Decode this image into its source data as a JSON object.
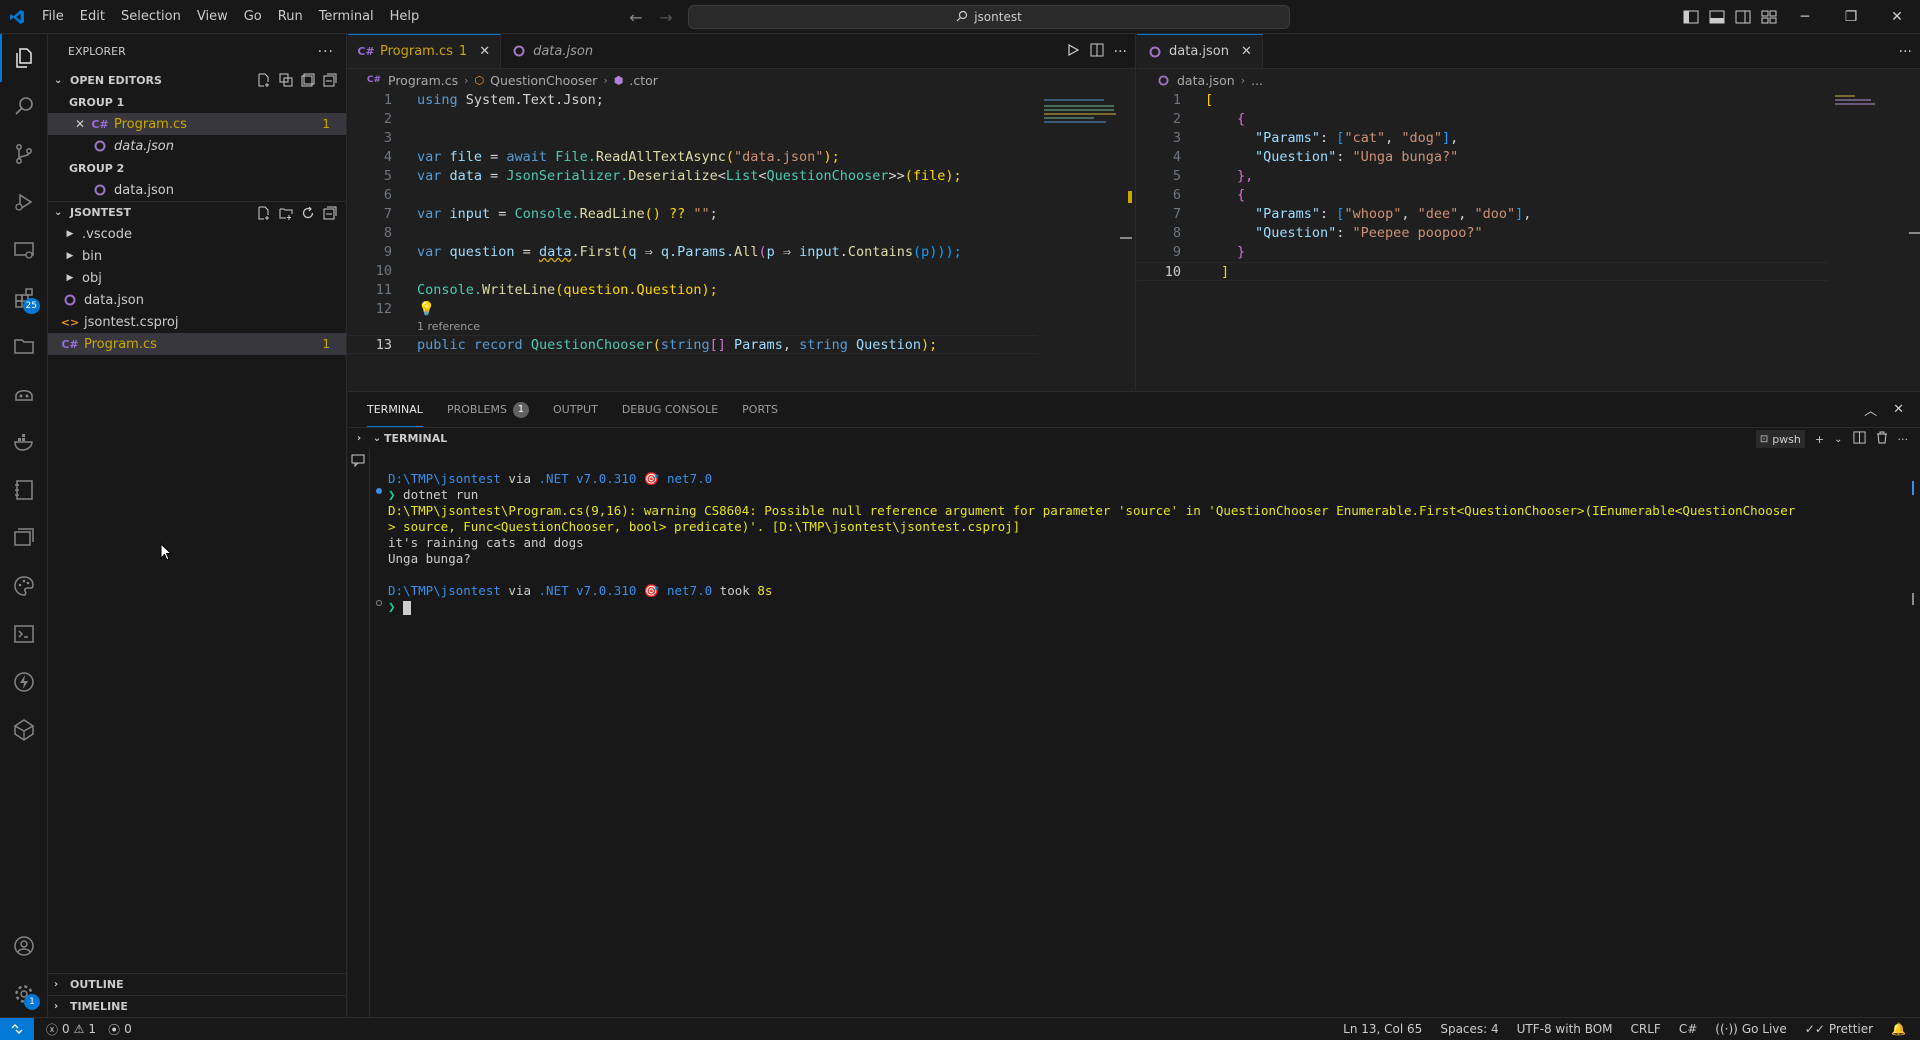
{
  "title_bar": {
    "menu": [
      "File",
      "Edit",
      "Selection",
      "View",
      "Go",
      "Run",
      "Terminal",
      "Help"
    ],
    "search_text": "jsontest"
  },
  "activity_bar": {
    "extensions_badge": "25",
    "settings_badge": "1"
  },
  "explorer": {
    "header": "EXPLORER",
    "open_editors": {
      "label": "OPEN EDITORS",
      "group1_label": "GROUP 1",
      "group2_label": "GROUP 2",
      "group1_files": [
        {
          "name": "Program.cs",
          "badge": "1"
        },
        {
          "name": "data.json"
        }
      ],
      "group2_files": [
        {
          "name": "data.json"
        }
      ]
    },
    "project": {
      "label": "JSONTEST",
      "items": [
        {
          "name": ".vscode"
        },
        {
          "name": "bin"
        },
        {
          "name": "obj"
        },
        {
          "name": "data.json"
        },
        {
          "name": "jsontest.csproj"
        },
        {
          "name": "Program.cs",
          "badge": "1"
        }
      ]
    },
    "outline_label": "OUTLINE",
    "timeline_label": "TIMELINE"
  },
  "editor_left": {
    "tabs": [
      {
        "label": "Program.cs",
        "suffix": "1"
      },
      {
        "label": "data.json"
      }
    ],
    "breadcrumb": [
      "Program.cs",
      "QuestionChooser",
      ".ctor"
    ],
    "line_numbers": [
      "1",
      "2",
      "3",
      "4",
      "5",
      "6",
      "7",
      "8",
      "9",
      "10",
      "11",
      "12",
      "13"
    ],
    "codelens": "1 reference",
    "code": {
      "l1": {
        "a": "using",
        "b": " System.Text.Json;"
      },
      "l4": {
        "a": "var",
        "b": " file",
        "c": " = ",
        "d": "await",
        "e": " File.",
        "f": "ReadAllTextAsync",
        "g": "(",
        "h": "\"data.json\"",
        "i": ");"
      },
      "l5": {
        "a": "var",
        "b": " data",
        "c": " = ",
        "d": "JsonSerializer.",
        "e": "Deserialize",
        "f": "<",
        "g": "List",
        "h": "<",
        "i": "QuestionChooser",
        "j": ">>",
        "k": "(file);"
      },
      "l7": {
        "a": "var",
        "b": " input",
        "c": " = ",
        "d": "Console.",
        "e": "ReadLine",
        "f": "() ?? ",
        "g": "\"\"",
        "h": ";"
      },
      "l9": {
        "a": "var",
        "b": " question",
        "c": " = ",
        "d": "data",
        "e": ".",
        "f": "First",
        "g": "(",
        "h": "q",
        "i": " ⇒ ",
        "j": "q",
        "k": ".Params.",
        "l": "All",
        "m": "(",
        "n": "p",
        "o": " ⇒ ",
        "p": "input",
        "q": ".",
        "r": "Contains",
        "s": "(p)));"
      },
      "l11": {
        "a": "Console.",
        "b": "WriteLine",
        "c": "(question.Question);"
      },
      "l13": {
        "a": "public",
        "b": " record",
        "c": " QuestionChooser",
        "d": "(",
        "e": "string",
        "f": "[]",
        "g": " Params",
        "h": ", ",
        "i": "string",
        "j": " Question",
        "k": ");"
      }
    }
  },
  "editor_right": {
    "tabs": [
      {
        "label": "data.json"
      }
    ],
    "breadcrumb": [
      "data.json",
      "..."
    ],
    "line_numbers": [
      "1",
      "2",
      "3",
      "4",
      "5",
      "6",
      "7",
      "8",
      "9",
      "10"
    ],
    "code": {
      "l1": "[",
      "l2": "{",
      "l3": {
        "key": "\"Params\"",
        "colon": ": ",
        "open": "[",
        "v1": "\"cat\"",
        "sep": ", ",
        "v2": "\"dog\"",
        "close": "]",
        "end": ","
      },
      "l4": {
        "key": "\"Question\"",
        "colon": ": ",
        "val": "\"Unga bunga?\""
      },
      "l5": "},",
      "l6": "{",
      "l7": {
        "key": "\"Params\"",
        "colon": ": ",
        "open": "[",
        "v1": "\"whoop\"",
        "sep1": ", ",
        "v2": "\"dee\"",
        "sep2": ", ",
        "v3": "\"doo\"",
        "close": "]",
        "end": ","
      },
      "l8": {
        "key": "\"Question\"",
        "colon": ": ",
        "val": "\"Peepee poopoo?\""
      },
      "l9": "}",
      "l10": "]"
    }
  },
  "panel": {
    "tabs": [
      "TERMINAL",
      "PROBLEMS",
      "OUTPUT",
      "DEBUG CONSOLE",
      "PORTS"
    ],
    "problems_count": "1",
    "terminal_header": "TERMINAL",
    "shell_name": "pwsh",
    "terminal": {
      "prompt1": {
        "path": "D:\\TMP\\jsontest",
        "via": " via ",
        "net": ".NET v7.0.310",
        "target": " 🎯 ",
        "tfm": "net7.0"
      },
      "cmd_arrow": "❯",
      "cmd": " dotnet run",
      "warn1": "D:\\TMP\\jsontest\\Program.cs(9,16): warning CS8604: Possible null reference argument for parameter 'source' in 'QuestionChooser Enumerable.First<QuestionChooser>(IEnumerable<QuestionChooser",
      "warn2": "> source, Func<QuestionChooser, bool> predicate)'. [D:\\TMP\\jsontest\\jsontest.csproj]",
      "out1": "it's raining cats and dogs",
      "out2": "Unga bunga?",
      "prompt2": {
        "path": "D:\\TMP\\jsontest",
        "via": " via ",
        "net": ".NET v7.0.310",
        "target": " 🎯 ",
        "tfm": "net7.0",
        "took": " took ",
        "time": "8s"
      }
    }
  },
  "status_bar": {
    "errors": "0",
    "warnings": "1",
    "ports": "0",
    "position": "Ln 13, Col 65",
    "spaces": "Spaces: 4",
    "encoding": "UTF-8 with BOM",
    "eol": "CRLF",
    "language": "C#",
    "go_live": "Go Live",
    "prettier": "Prettier"
  }
}
